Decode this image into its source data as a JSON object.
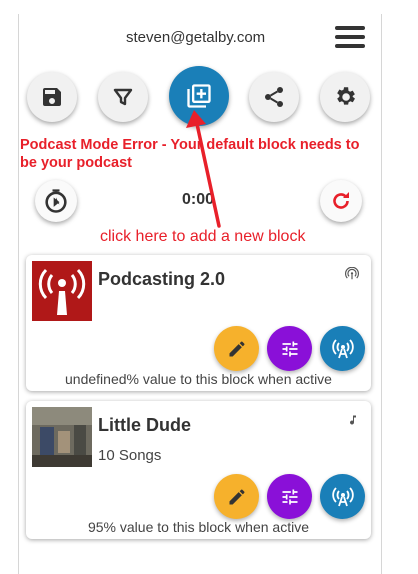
{
  "header": {
    "email": "steven@getalby.com"
  },
  "error_message": "Podcast Mode Error - Your default block needs to be your podcast",
  "timer": {
    "value": "0:00"
  },
  "hint": "click here to add a new block",
  "icons": {
    "menu": "hamburger-menu-icon",
    "save": "save-icon",
    "filter": "filter-icon",
    "add_block": "add-block-icon",
    "share": "share-icon",
    "settings": "gear-icon",
    "timer": "timer-icon",
    "refresh": "refresh-icon"
  },
  "colors": {
    "primary": "#1a7fb8",
    "error": "#e8202a",
    "edit": "#f6b12c",
    "adjust": "#8a10d8"
  },
  "blocks": [
    {
      "title": "Podcasting 2.0",
      "subtitle": "",
      "footer": "undefined% value to this block when active",
      "type_icon": "podcast-icon"
    },
    {
      "title": "Little Dude",
      "subtitle": "10 Songs",
      "footer": "95% value to this block when active",
      "type_icon": "music-note-icon"
    }
  ]
}
